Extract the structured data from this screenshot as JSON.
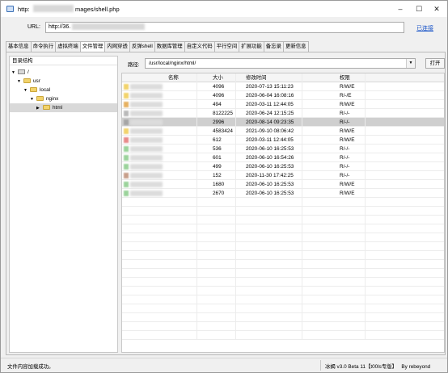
{
  "window": {
    "title_prefix": "http:",
    "title_suffix": "mages/shell.php",
    "minimize": "–",
    "maximize": "☐",
    "close": "✕"
  },
  "url_bar": {
    "label": "URL:",
    "value_prefix": "http://36.",
    "connect_label": "已连接"
  },
  "tabs": [
    {
      "label": "基本信息",
      "active": false
    },
    {
      "label": "命令执行",
      "active": false
    },
    {
      "label": "虚拟终端",
      "active": false
    },
    {
      "label": "文件管理",
      "active": true
    },
    {
      "label": "内网穿透",
      "active": false
    },
    {
      "label": "反弹shell",
      "active": false
    },
    {
      "label": "数据库管理",
      "active": false
    },
    {
      "label": "自定义代码",
      "active": false
    },
    {
      "label": "平行空间",
      "active": false
    },
    {
      "label": "扩展功能",
      "active": false
    },
    {
      "label": "备忘录",
      "active": false
    },
    {
      "label": "更新信息",
      "active": false
    }
  ],
  "tree": {
    "header": "目录结构",
    "nodes": [
      {
        "label": "/",
        "icon": "drive-icon",
        "arrow": "▼"
      },
      {
        "label": "usr",
        "icon": "folder-icon",
        "arrow": "▼"
      },
      {
        "label": "local",
        "icon": "folder-icon",
        "arrow": "▼"
      },
      {
        "label": "nginx",
        "icon": "folder-icon",
        "arrow": "▼"
      },
      {
        "label": "html",
        "icon": "folder-icon",
        "arrow": "▶"
      }
    ]
  },
  "path": {
    "label": "路径:",
    "value": "/usr/local/nginx/html/",
    "open_label": "打开"
  },
  "table": {
    "columns": [
      "名称",
      "大小",
      "修改时间",
      "权限"
    ],
    "rows": [
      {
        "size": "4096",
        "mtime": "2020-07-13 15:11:23",
        "perm": "R/W/E",
        "icon_color": "#f2d36b"
      },
      {
        "size": "4096",
        "mtime": "2020-06-04 16:08:16",
        "perm": "R/-/E",
        "icon_color": "#f2d36b"
      },
      {
        "size": "494",
        "mtime": "2020-03-11 12:44:05",
        "perm": "R/W/E",
        "icon_color": "#e6b060"
      },
      {
        "size": "8122225",
        "mtime": "2020-06-24 12:15:25",
        "perm": "R/-/-",
        "icon_color": "#b9b9b9"
      },
      {
        "size": "2996",
        "mtime": "2020-08-14 09:23:35",
        "perm": "R/-/-",
        "icon_color": "#a5a5a5"
      },
      {
        "size": "4583424",
        "mtime": "2021-09-10 08:06:42",
        "perm": "R/W/E",
        "icon_color": "#f2d36b"
      },
      {
        "size": "612",
        "mtime": "2020-03-11 12:44:05",
        "perm": "R/W/E",
        "icon_color": "#e88a8a"
      },
      {
        "size": "536",
        "mtime": "2020-06-10 16:25:53",
        "perm": "R/-/-",
        "icon_color": "#9bd39b"
      },
      {
        "size": "601",
        "mtime": "2020-06-10 16:54:26",
        "perm": "R/-/-",
        "icon_color": "#9bd39b"
      },
      {
        "size": "499",
        "mtime": "2020-06-10 16:25:53",
        "perm": "R/-/-",
        "icon_color": "#9bd39b"
      },
      {
        "size": "152",
        "mtime": "2020-11-30 17:42:25",
        "perm": "R/-/-",
        "icon_color": "#c79f8a"
      },
      {
        "size": "1680",
        "mtime": "2020-06-10 16:25:53",
        "perm": "R/W/E",
        "icon_color": "#9bd39b"
      },
      {
        "size": "2670",
        "mtime": "2020-06-10 16:25:53",
        "perm": "R/W/E",
        "icon_color": "#9bd39b"
      }
    ],
    "selected_row": 4,
    "empty_rows": 16
  },
  "status": {
    "message": "文件内容加载成功。",
    "version": "冰蝎 v3.0 Beta 11【t00ls专版】",
    "author": "By rebeyond"
  }
}
